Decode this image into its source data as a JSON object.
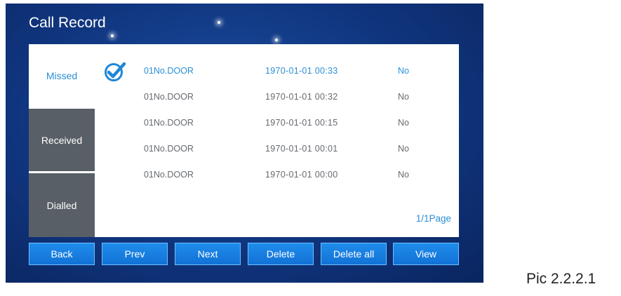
{
  "screen": {
    "title": "Call Record"
  },
  "tabs": [
    {
      "label": "Missed",
      "active": true
    },
    {
      "label": "Received",
      "active": false
    },
    {
      "label": "Dialled",
      "active": false
    }
  ],
  "records": [
    {
      "name": "01No.DOOR",
      "datetime": "1970-01-01  00:33",
      "status": "No",
      "selected": true
    },
    {
      "name": "01No.DOOR",
      "datetime": "1970-01-01  00:32",
      "status": "No",
      "selected": false
    },
    {
      "name": "01No.DOOR",
      "datetime": "1970-01-01  00:15",
      "status": "No",
      "selected": false
    },
    {
      "name": "01No.DOOR",
      "datetime": "1970-01-01  00:01",
      "status": "No",
      "selected": false
    },
    {
      "name": "01No.DOOR",
      "datetime": "1970-01-01  00:00",
      "status": "No",
      "selected": false
    }
  ],
  "pagination": {
    "text": "1/1Page"
  },
  "buttons": {
    "back": "Back",
    "prev": "Prev",
    "next": "Next",
    "delete": "Delete",
    "delete_all": "Delete all",
    "view": "View"
  },
  "caption": "Pic 2.2.2.1",
  "colors": {
    "accent_blue": "#2b8fd6",
    "button_blue": "#1a7fe0",
    "tab_gray": "#585f66",
    "background_navy": "#10357e"
  },
  "icons": {
    "selected_marker": "check-circle-icon"
  }
}
